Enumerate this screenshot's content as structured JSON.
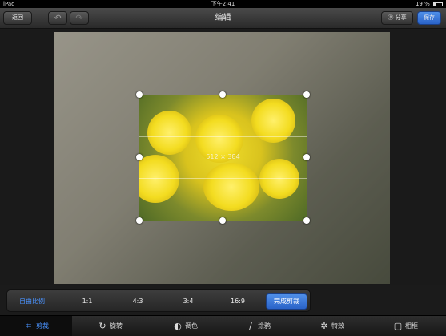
{
  "status": {
    "device": "iPad",
    "time": "下午2:41",
    "battery": "19 %"
  },
  "nav": {
    "back": "返回",
    "title": "编辑",
    "share": "分享",
    "save": "保存",
    "undo_icon": "undo-arrow",
    "redo_icon": "redo-arrow"
  },
  "crop": {
    "dimensions": "512 × 384"
  },
  "aspect": {
    "options": [
      "自由比例",
      "1:1",
      "4:3",
      "3:4",
      "16:9"
    ],
    "done": "完成剪裁"
  },
  "toolbar": {
    "items": [
      "剪裁",
      "旋转",
      "调色",
      "涂鸦",
      "特效",
      "相框"
    ]
  },
  "colors": {
    "accent": "#4a93ff",
    "primary_button": "#2a63c8"
  }
}
